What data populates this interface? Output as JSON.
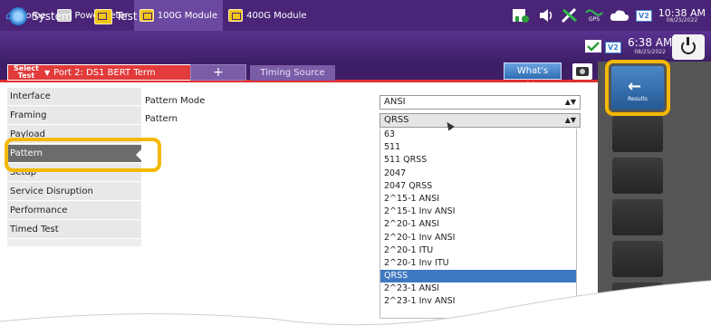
{
  "topbar": {
    "home": "Home",
    "powermeter": "PowerMeter",
    "module_100g": "100G Module",
    "module_400g": "400G Module",
    "gps": "GPS",
    "v2": "V2",
    "time": "10:38 AM",
    "date": "08/25/2022"
  },
  "bar2": {
    "system": "System",
    "test": "Test",
    "v2": "V2",
    "time": "6:38 AM",
    "date": "08/25/2022"
  },
  "tabs": {
    "select_line1": "Select",
    "select_line2": "Test",
    "port": "Port 2: DS1 BERT Term",
    "close": "✕",
    "plus": "+",
    "timing": "Timing Source",
    "whats_this": "What's This?"
  },
  "results": {
    "label": "Results"
  },
  "nav": {
    "items": [
      "Interface",
      "Framing",
      "Payload",
      "Pattern",
      "Setup",
      "Service Disruption",
      "Performance",
      "Timed Test"
    ],
    "active": "Pattern"
  },
  "main": {
    "pattern_mode_label": "Pattern Mode",
    "pattern_mode_value": "ANSI",
    "pattern_label": "Pattern",
    "pattern_value": "QRSS",
    "options": [
      "63",
      "511",
      "511 QRSS",
      "2047",
      "2047 QRSS",
      "2^15-1 ANSI",
      "2^15-1 Inv ANSI",
      "2^20-1 ANSI",
      "2^20-1 Inv ANSI",
      "2^20-1 ITU",
      "2^20-1 Inv ITU",
      "QRSS",
      "2^23-1 ANSI",
      "2^23-1 Inv ANSI"
    ],
    "selected_option": "QRSS"
  }
}
